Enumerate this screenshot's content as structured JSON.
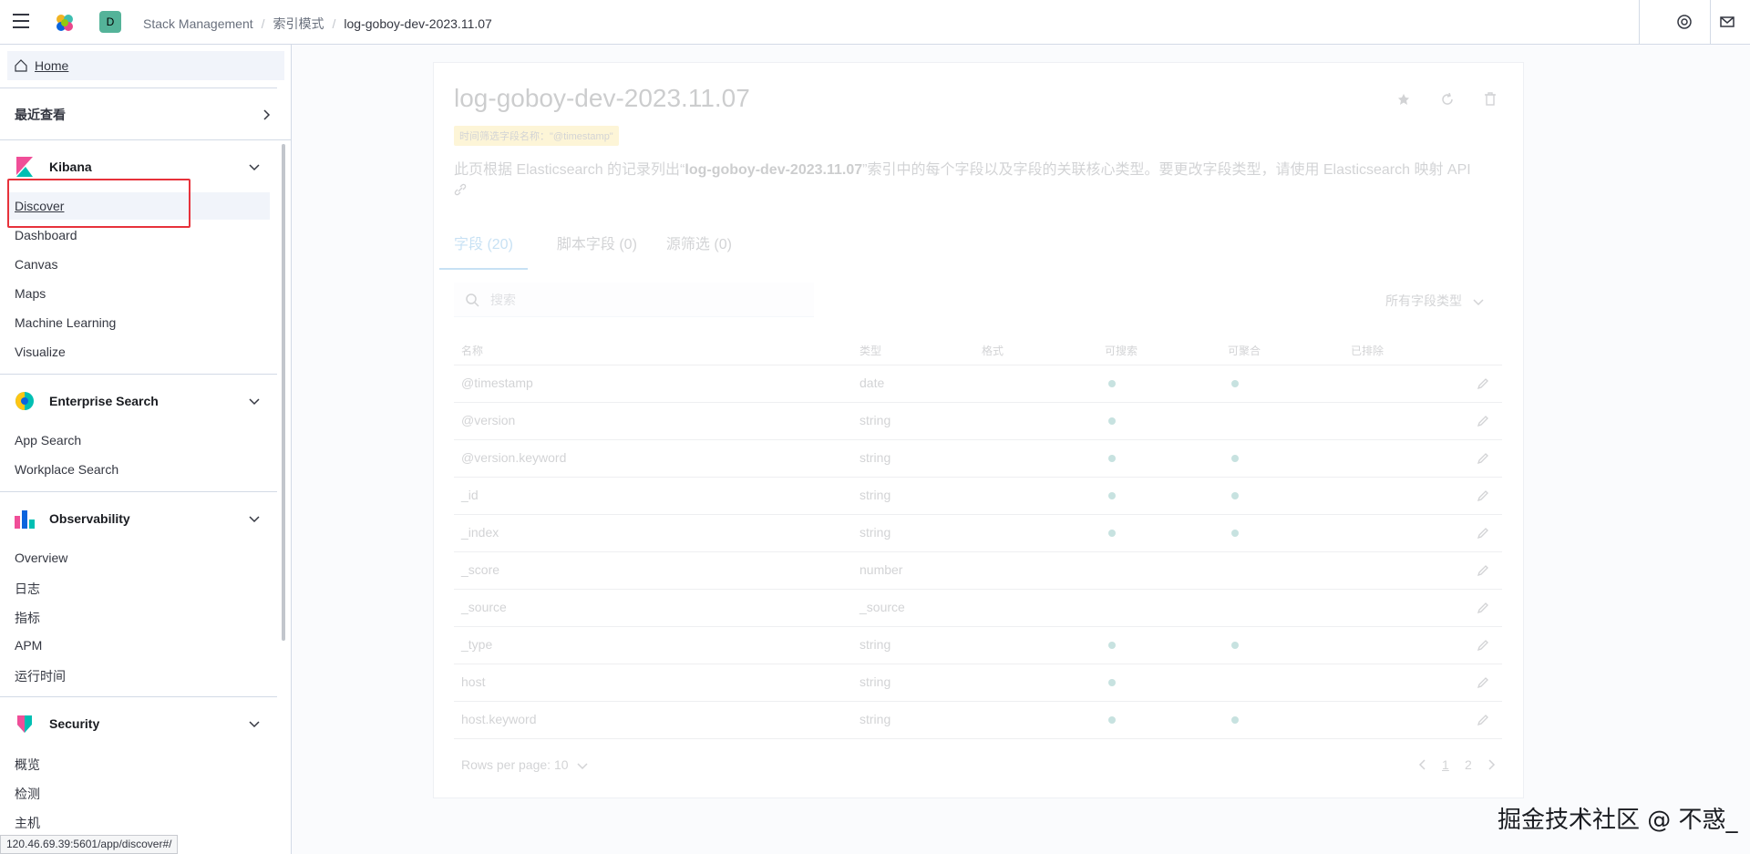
{
  "header": {
    "space_initial": "D",
    "breadcrumbs": [
      "Stack Management",
      "索引模式",
      "log-goboy-dev-2023.11.07"
    ]
  },
  "sidebar": {
    "home": "Home",
    "recent": "最近查看",
    "groups": [
      {
        "title": "Kibana",
        "items": [
          "Discover",
          "Dashboard",
          "Canvas",
          "Maps",
          "Machine Learning",
          "Visualize"
        ]
      },
      {
        "title": "Enterprise Search",
        "items": [
          "App Search",
          "Workplace Search"
        ]
      },
      {
        "title": "Observability",
        "items": [
          "Overview",
          "日志",
          "指标",
          "APM",
          "运行时间"
        ]
      },
      {
        "title": "Security",
        "items": [
          "概览",
          "检测",
          "主机"
        ]
      }
    ],
    "status_url": "120.46.69.39:5601/app/discover#/"
  },
  "main": {
    "title": "log-goboy-dev-2023.11.07",
    "timestamp_badge": "时间筛选字段名称：\"@timestamp\"",
    "description_pre": "此页根据 Elasticsearch 的记录列出“",
    "description_bold": "log-goboy-dev-2023.11.07",
    "description_post": "”索引中的每个字段以及字段的关联核心类型。要更改字段类型，请使用 Elasticsearch 映射 API",
    "tabs": [
      "字段 (20)",
      "脚本字段 (0)",
      "源筛选 (0)"
    ],
    "search_placeholder": "搜索",
    "type_filter": "所有字段类型",
    "columns": [
      "名称",
      "类型",
      "格式",
      "可搜索",
      "可聚合",
      "已排除"
    ],
    "rows": [
      {
        "name": "@timestamp",
        "type": "date",
        "searchable": true,
        "aggregatable": true
      },
      {
        "name": "@version",
        "type": "string",
        "searchable": true,
        "aggregatable": false
      },
      {
        "name": "@version.keyword",
        "type": "string",
        "searchable": true,
        "aggregatable": true
      },
      {
        "name": "_id",
        "type": "string",
        "searchable": true,
        "aggregatable": true
      },
      {
        "name": "_index",
        "type": "string",
        "searchable": true,
        "aggregatable": true
      },
      {
        "name": "_score",
        "type": "number",
        "searchable": false,
        "aggregatable": false
      },
      {
        "name": "_source",
        "type": "_source",
        "searchable": false,
        "aggregatable": false
      },
      {
        "name": "_type",
        "type": "string",
        "searchable": true,
        "aggregatable": true
      },
      {
        "name": "host",
        "type": "string",
        "searchable": true,
        "aggregatable": false
      },
      {
        "name": "host.keyword",
        "type": "string",
        "searchable": true,
        "aggregatable": true
      }
    ],
    "rows_per_page": "Rows per page: 10",
    "pages": [
      "1",
      "2"
    ]
  },
  "watermark": "掘金技术社区 @ 不惑_"
}
